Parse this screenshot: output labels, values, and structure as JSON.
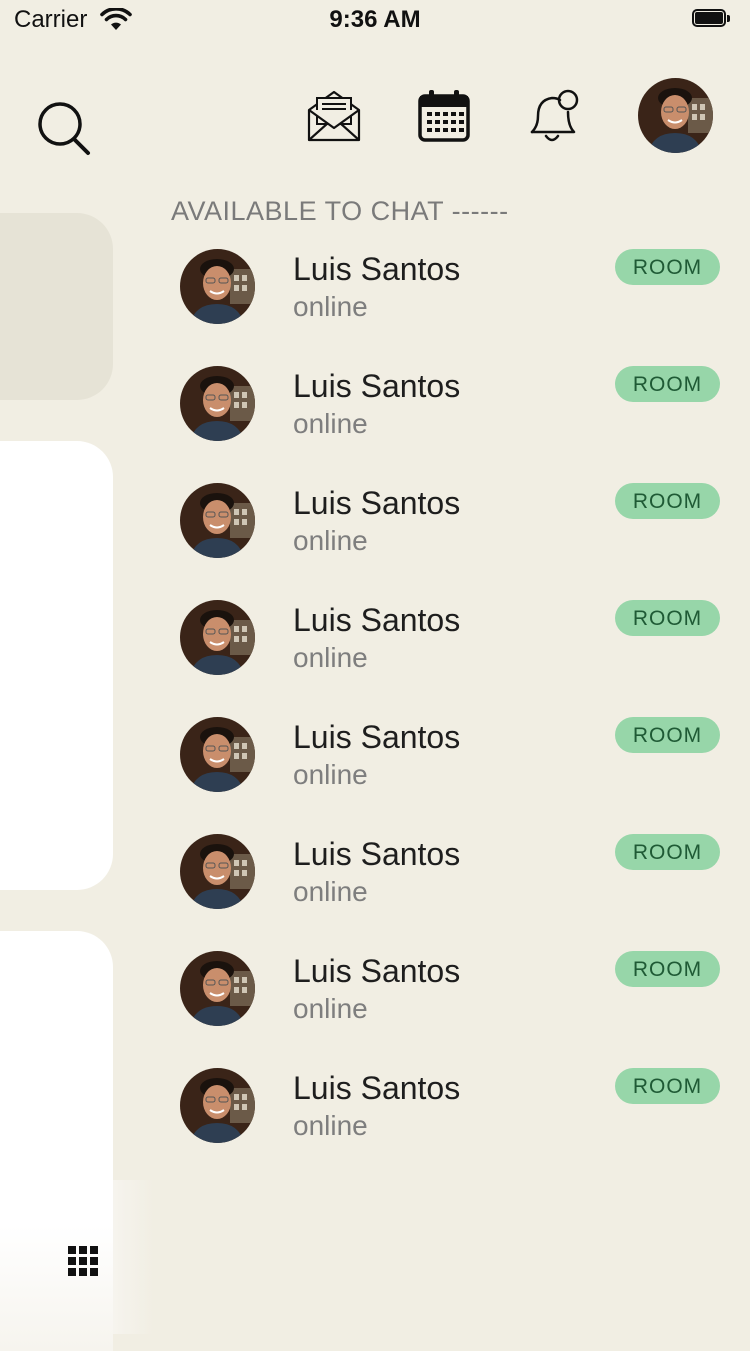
{
  "status_bar": {
    "carrier": "Carrier",
    "time": "9:36 AM",
    "icons": [
      "wifi-icon",
      "battery-icon"
    ]
  },
  "header": {
    "icons": [
      "search-icon",
      "mail-open-icon",
      "calendar-icon",
      "bell-notification-icon",
      "profile-avatar"
    ]
  },
  "section_title": "AVAILABLE TO CHAT ------",
  "contacts": [
    {
      "name": "Luis Santos",
      "status": "online",
      "badge": "ROOM"
    },
    {
      "name": "Luis Santos",
      "status": "online",
      "badge": "ROOM"
    },
    {
      "name": "Luis Santos",
      "status": "online",
      "badge": "ROOM"
    },
    {
      "name": "Luis Santos",
      "status": "online",
      "badge": "ROOM"
    },
    {
      "name": "Luis Santos",
      "status": "online",
      "badge": "ROOM"
    },
    {
      "name": "Luis Santos",
      "status": "online",
      "badge": "ROOM"
    },
    {
      "name": "Luis Santos",
      "status": "online",
      "badge": "ROOM"
    },
    {
      "name": "Luis Santos",
      "status": "online",
      "badge": "ROOM"
    }
  ],
  "colors": {
    "background": "#F1EEE3",
    "badge": "#97D6A9",
    "badge_text": "#1F5A35",
    "panel": "#FFFFFF"
  }
}
